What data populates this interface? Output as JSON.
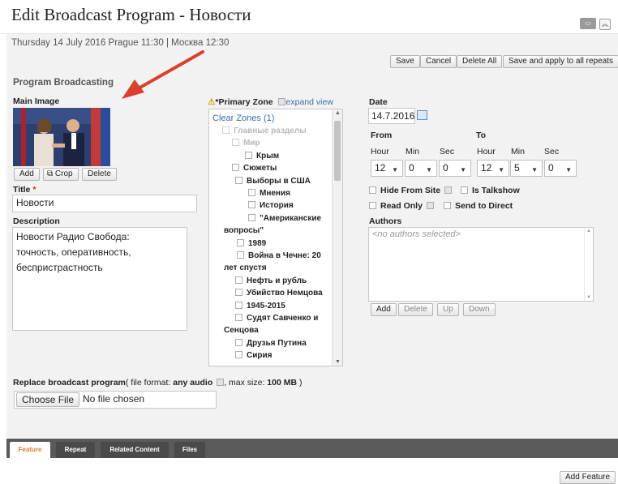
{
  "page": {
    "title": "Edit Broadcast Program - Новости",
    "datetime": "Thursday 14 July 2016 Prague 11:30 | Москва 12:30"
  },
  "toolbar": {
    "save": "Save",
    "cancel": "Cancel",
    "delete_all": "Delete All",
    "save_apply": "Save and apply to all repeats"
  },
  "section": "Program Broadcasting",
  "main_image": {
    "label": "Main Image",
    "add": "Add",
    "crop": "Crop",
    "delete": "Delete"
  },
  "title_field": {
    "label": "Title",
    "required_mark": "*",
    "value": "Новости"
  },
  "description": {
    "label": "Description",
    "value": "Новости Радио Свобода:\nточность, оперативность,\nбеспристрастность"
  },
  "zones": {
    "label": "*Primary Zone",
    "expand": "expand view",
    "clear": "Clear Zones (1)",
    "items": [
      {
        "label": "Главные разделы",
        "grey": true
      },
      {
        "label": "Мир",
        "grey": true
      },
      {
        "label": "Крым",
        "grey": false
      },
      {
        "label": "Сюжеты",
        "grey": false
      },
      {
        "label": "Выборы в США",
        "grey": false
      },
      {
        "label": "Мнения",
        "grey": false
      },
      {
        "label": "История",
        "grey": false
      },
      {
        "label": "\"Американские",
        "grey": false
      },
      {
        "label": "вопросы\"",
        "grey": false
      },
      {
        "label": "1989",
        "grey": false
      },
      {
        "label": "Война в Чечне: 20",
        "grey": false
      },
      {
        "label": "лет спустя",
        "grey": false
      },
      {
        "label": "Нефть и рубль",
        "grey": false
      },
      {
        "label": "Убийство Немцова",
        "grey": false
      },
      {
        "label": "1945-2015",
        "grey": false
      },
      {
        "label": "Судят Савченко и",
        "grey": false
      },
      {
        "label": "Сенцова",
        "grey": false
      },
      {
        "label": "Друзья Путина",
        "grey": false
      },
      {
        "label": "Сирия",
        "grey": false
      }
    ]
  },
  "date": {
    "label": "Date",
    "value": "14.7.2016",
    "from": "From",
    "to": "To",
    "hour": "Hour",
    "min": "Min",
    "sec": "Sec",
    "from_values": [
      "12",
      "0",
      "0"
    ],
    "to_values": [
      "12",
      "5",
      "0"
    ]
  },
  "flags": {
    "hide": "Hide From Site",
    "talkshow": "Is Talkshow",
    "readonly": "Read Only",
    "direct": "Send to Direct"
  },
  "authors": {
    "label": "Authors",
    "placeholder": "<no authors selected>",
    "add": "Add",
    "delete": "Delete",
    "up": "Up",
    "down": "Down"
  },
  "upload": {
    "label_start": "Replace broadcast program",
    "label_mid": "( file format: ",
    "format": "any audio",
    "size_label": ", max size: ",
    "size": "100 MB",
    "close": " )",
    "button": "Choose File",
    "status": "No file chosen"
  },
  "tabs": [
    "Feature",
    "Repeat",
    "Related Content",
    "Files"
  ],
  "add_feature": "Add Feature",
  "colors": {
    "tab_active": "#e07a2a",
    "link": "#3a6ea8",
    "arrow": "#d9412d"
  }
}
